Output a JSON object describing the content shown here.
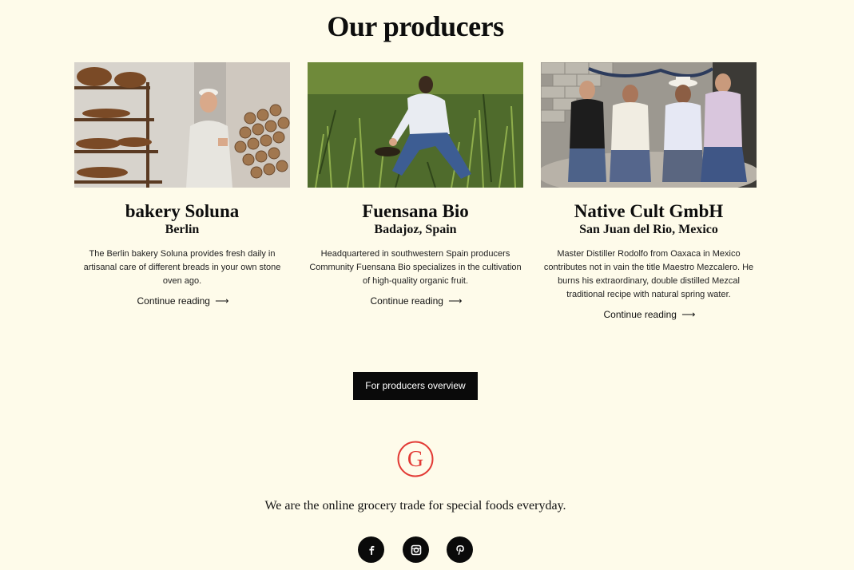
{
  "section": {
    "title": "Our producers"
  },
  "producers": [
    {
      "name": "bakery Soluna",
      "location": "Berlin",
      "description": "The Berlin bakery Soluna provides fresh daily in artisanal care of different breads in your own stone oven ago.",
      "link_label": "Continue reading"
    },
    {
      "name": "Fuensana Bio",
      "location": "Badajoz, Spain",
      "description": "Headquartered in southwestern Spain producers Community Fuensana Bio specializes in the cultivation of high-quality organic fruit.",
      "link_label": "Continue reading"
    },
    {
      "name": "Native Cult GmbH",
      "location": "San Juan del Rio, Mexico",
      "description": "Master Distiller Rodolfo from Oaxaca in Mexico contributes not in vain the title Maestro Mezcalero. He burns his extraordinary, double distilled Mezcal traditional recipe with natural spring water.",
      "link_label": "Continue reading"
    }
  ],
  "arrow": "⟶",
  "overview_button": "For producers overview",
  "logo": {
    "letter": "G",
    "color": "#e23a35"
  },
  "footer": {
    "tagline": "We are the online grocery trade for special foods everyday."
  },
  "social": [
    "facebook-icon",
    "instagram-icon",
    "pinterest-icon"
  ],
  "colors": {
    "background": "#fefbea",
    "button": "#0a0a0a",
    "accent": "#e23a35"
  }
}
